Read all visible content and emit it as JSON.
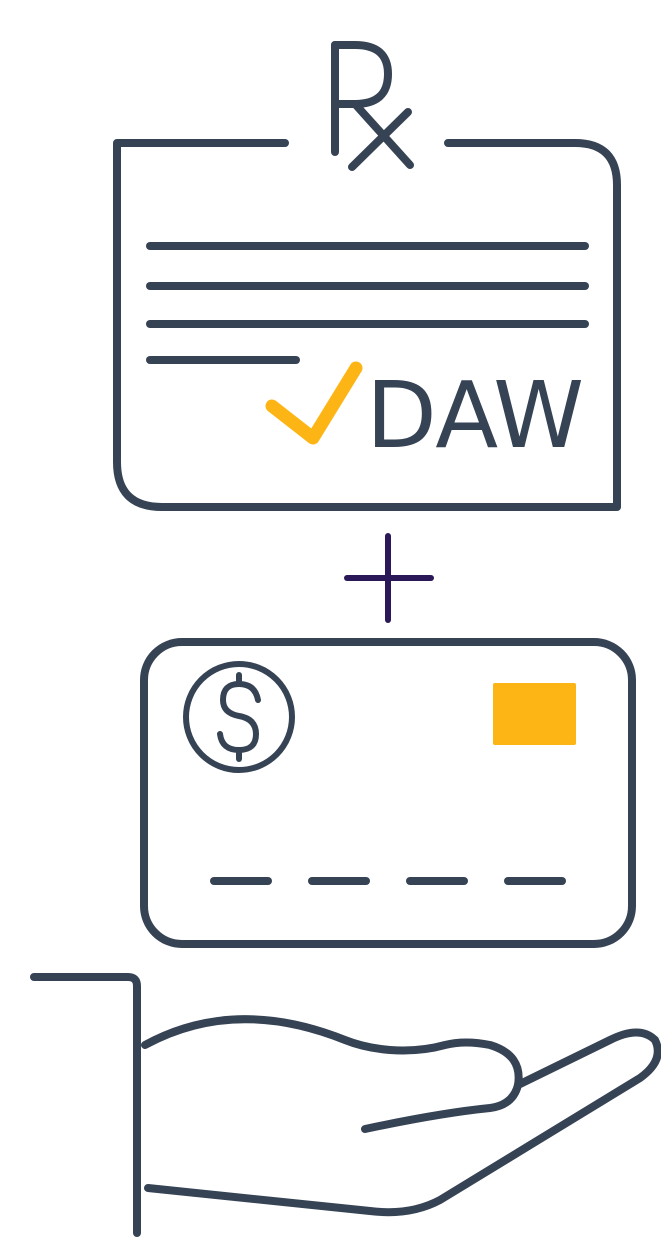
{
  "prescription": {
    "symbol": "Rx",
    "stamp_label": "DAW"
  },
  "operator": {
    "symbol": "+"
  },
  "payment_card": {
    "currency_symbol": "$"
  },
  "colors": {
    "outline": "#364354",
    "accent": "#fdb515",
    "plus": "#2b1858",
    "background": "#ffffff"
  },
  "icons": [
    "prescription-rx-icon",
    "checkmark-icon",
    "plus-icon",
    "credit-card-icon",
    "dollar-coin-icon",
    "card-chip-icon",
    "open-hand-icon"
  ]
}
